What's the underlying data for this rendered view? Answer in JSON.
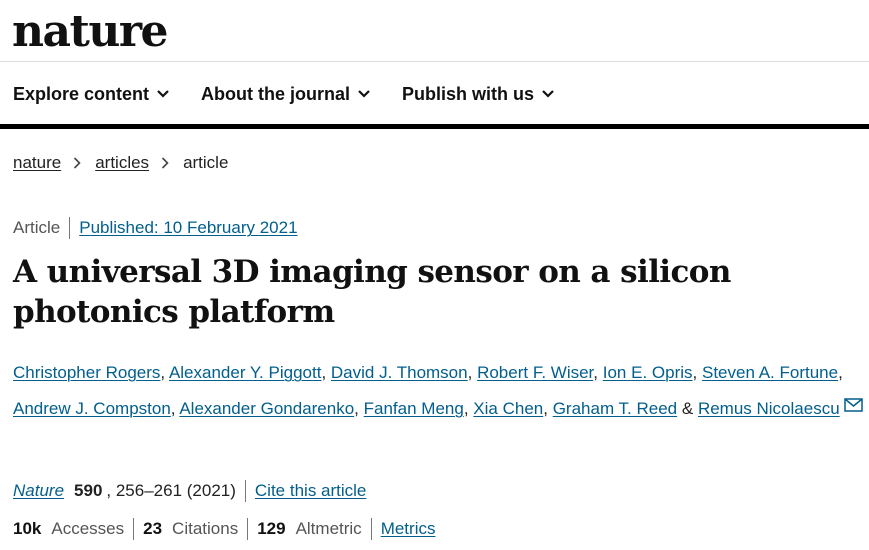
{
  "header": {
    "logo_text": "nature",
    "nav": [
      {
        "label": "Explore content"
      },
      {
        "label": "About the journal"
      },
      {
        "label": "Publish with us"
      }
    ]
  },
  "breadcrumb": [
    "nature",
    "articles",
    "article"
  ],
  "article": {
    "type": "Article",
    "published": "Published: 10 February 2021",
    "title": "A universal 3D imaging sensor on a silicon photonics platform",
    "authors": [
      "Christopher Rogers",
      "Alexander Y. Piggott",
      "David J. Thomson",
      "Robert F. Wiser",
      "Ion E. Opris",
      "Steven A. Fortune",
      "Andrew J. Compston",
      "Alexander Gondarenko",
      "Fanfan Meng",
      "Xia Chen",
      "Graham T. Reed",
      "Remus Nicolaescu"
    ],
    "authors_separator": ",",
    "authors_last_joiner": "&",
    "corresponding_icon": "mail-icon",
    "citation": {
      "journal": "Nature",
      "volume": "590",
      "pages": ", 256–261 (2021)",
      "cite_link": "Cite this article"
    },
    "metrics": {
      "accesses_value": "10k",
      "accesses_label": "Accesses",
      "citations_value": "23",
      "citations_label": "Citations",
      "altmetric_value": "129",
      "altmetric_label": "Altmetric",
      "metrics_link": "Metrics"
    }
  },
  "colors": {
    "link": "#025e8d",
    "text": "#222222",
    "muted": "#555555",
    "bar": "#000000"
  }
}
